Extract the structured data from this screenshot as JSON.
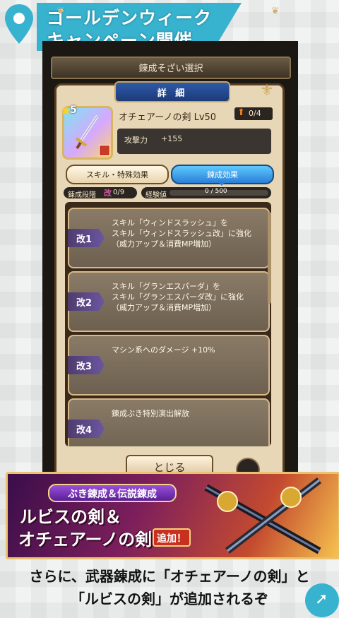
{
  "header": {
    "line1": "ゴールデンウィーク",
    "line2": "キャンペーン開催",
    "accent": "#37b3cf"
  },
  "topbar": {
    "title": "錬成そざい選択"
  },
  "detail": {
    "tab_label": "詳 細"
  },
  "weapon": {
    "rarity": "5",
    "name": "オチェアーノの剣 Lv50",
    "plus": "0/4",
    "stat_name": "攻撃力",
    "stat_value": "+155"
  },
  "tabs": {
    "skill": "スキル・特殊効果",
    "ren": "錬成効果"
  },
  "progress": {
    "stage_label": "錬成段階",
    "stage_icon": "改",
    "stage_value": "0/9",
    "exp_label": "経験値",
    "exp_value": "0 / 500",
    "exp_fraction": 0
  },
  "cards": [
    {
      "tag": "改1",
      "text": "スキル「ウィンドスラッシュ」を\nスキル「ウィンドスラッシュ改」に強化\n（威力アップ＆消費MP増加）"
    },
    {
      "tag": "改2",
      "text": "スキル「グランエスパーダ」を\nスキル「グランエスパーダ改」に強化\n（威力アップ＆消費MP増加）"
    },
    {
      "tag": "改3",
      "text": "マシン系へのダメージ +10%"
    },
    {
      "tag": "改4",
      "text": "錬成ぶき特別演出解放"
    }
  ],
  "close_label": "とじる",
  "banner": {
    "pill": "ぶき錬成＆伝説錬成",
    "line1": "ルビスの剣＆",
    "line2": "オチェアーノの剣",
    "add": "追加！"
  },
  "caption": {
    "line1": "さらに、武器錬成に「オチェアーノの剣」と",
    "line2": "「ルビスの剣」が追加されるぞ"
  }
}
